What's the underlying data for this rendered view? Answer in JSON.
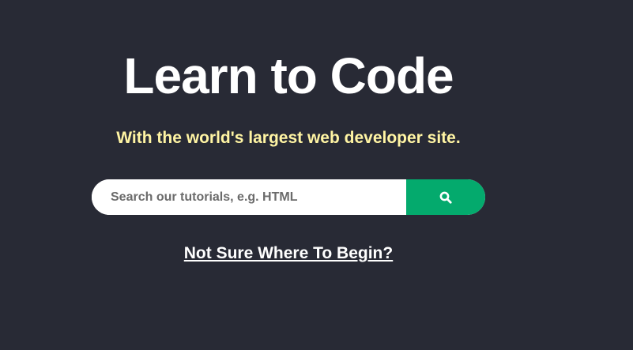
{
  "hero": {
    "title": "Learn to Code",
    "subtitle": "With the world's largest web developer site.",
    "search": {
      "placeholder": "Search our tutorials, e.g. HTML",
      "value": "",
      "button_icon": "search-icon"
    },
    "link_text": "Not Sure Where To Begin?"
  },
  "colors": {
    "background": "#282a35",
    "subtitle": "#fff4a3",
    "accent": "#04aa6d"
  }
}
